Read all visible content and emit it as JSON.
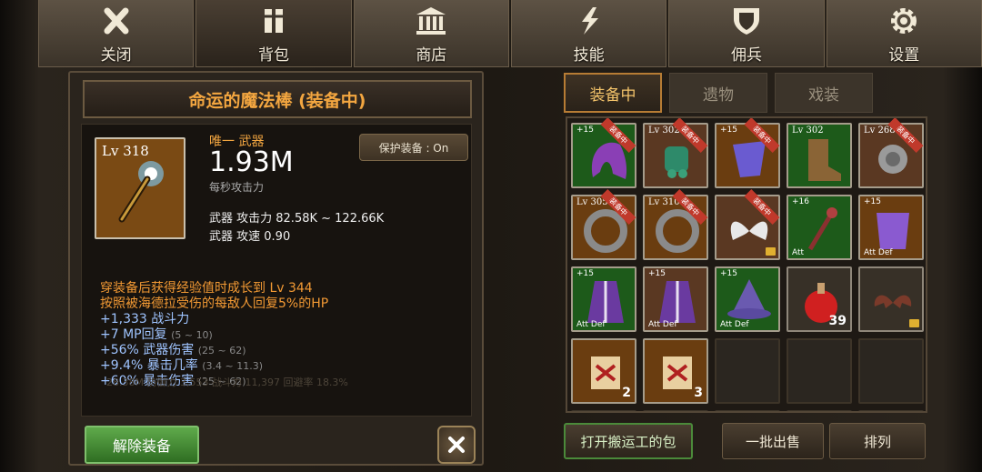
{
  "top_tabs": [
    {
      "label": "关闭",
      "icon": "close-icon"
    },
    {
      "label": "背包",
      "icon": "backpack-icon"
    },
    {
      "label": "商店",
      "icon": "shop-icon"
    },
    {
      "label": "技能",
      "icon": "skill-icon"
    },
    {
      "label": "佣兵",
      "icon": "mercenary-shield-icon"
    },
    {
      "label": "设置",
      "icon": "gear-icon"
    }
  ],
  "item": {
    "title": "命运的魔法棒 (装备中)",
    "level": "Lv 318",
    "type": "唯一 武器",
    "dps": "1.93M",
    "dps_label": "每秒攻击力",
    "protect": "保护装备 : On",
    "attack": "武器 攻击力 82.58K ~ 122.66K",
    "speed": "武器 攻速 0.90",
    "bonuses_orange": [
      "穿装备后获得经验值时成长到 Lv 344",
      "按照被海德拉受伤的每敌人回复5%的HP"
    ],
    "bonuses_blue": [
      {
        "text": "+1,333 战斗力",
        "range": ""
      },
      {
        "text": "+7 MP回复",
        "range": "(5 ~ 10)"
      },
      {
        "text": "+56% 武器伤害",
        "range": "(25 ~ 62)"
      },
      {
        "text": "+9.4% 暴击几率",
        "range": "(3.4 ~ 11.3)"
      },
      {
        "text": "+60% 暴击伤害",
        "range": "(25 ~ 62)"
      }
    ]
  },
  "ghost_text": "28.38M  防御力  3,553  战斗力  11,397  回避率  18.3%",
  "unequip_label": "解除装备",
  "inv_tabs": [
    "装备中",
    "遗物",
    "戏装"
  ],
  "slots": [
    {
      "bg": "g",
      "plus": "+15",
      "eq": "装备中",
      "icon": "hood-icon"
    },
    {
      "bg": "r",
      "lv": "Lv 302",
      "eq": "装备中",
      "icon": "gauntlet-icon"
    },
    {
      "bg": "o",
      "plus": "+15",
      "eq": "装备中",
      "icon": "cloak-icon"
    },
    {
      "bg": "g",
      "lv": "Lv 302",
      "eq": "",
      "icon": "boots-icon"
    },
    {
      "bg": "r",
      "lv": "Lv 268",
      "eq": "装备中",
      "icon": "amulet-icon"
    },
    {
      "bg": "o",
      "lv": "Lv 305",
      "eq": "装备中",
      "icon": "ring-icon"
    },
    {
      "bg": "o",
      "lv": "Lv 310",
      "eq": "装备中",
      "icon": "ring-icon"
    },
    {
      "bg": "r",
      "eq": "装备中",
      "icon": "wings-icon",
      "lock": true
    },
    {
      "bg": "g",
      "plus": "+16",
      "ad": "Att",
      "icon": "staff-icon"
    },
    {
      "bg": "o",
      "plus": "+15",
      "ad": "Att Def",
      "icon": "armor-icon"
    },
    {
      "bg": "g",
      "plus": "+15",
      "ad": "Att Def",
      "icon": "robe-icon"
    },
    {
      "bg": "r",
      "plus": "+15",
      "ad": "Att Def",
      "icon": "robe-icon"
    },
    {
      "bg": "g",
      "plus": "+15",
      "ad": "Att Def",
      "icon": "hat-icon"
    },
    {
      "bg": "n",
      "cnt": "39",
      "icon": "potion-icon"
    },
    {
      "bg": "n",
      "icon": "bat-wings-icon",
      "lock": true
    },
    {
      "bg": "o",
      "cnt": "2",
      "icon": "scroll-icon"
    },
    {
      "bg": "o",
      "cnt": "3",
      "icon": "scroll-icon"
    },
    {
      "bg": "e"
    },
    {
      "bg": "e"
    },
    {
      "bg": "e"
    },
    {
      "bg": "e"
    },
    {
      "bg": "e"
    },
    {
      "bg": "e"
    },
    {
      "bg": "e"
    },
    {
      "bg": "e"
    }
  ],
  "bottom_buttons": [
    "打开搬运工的包",
    "一批出售",
    "排列"
  ]
}
